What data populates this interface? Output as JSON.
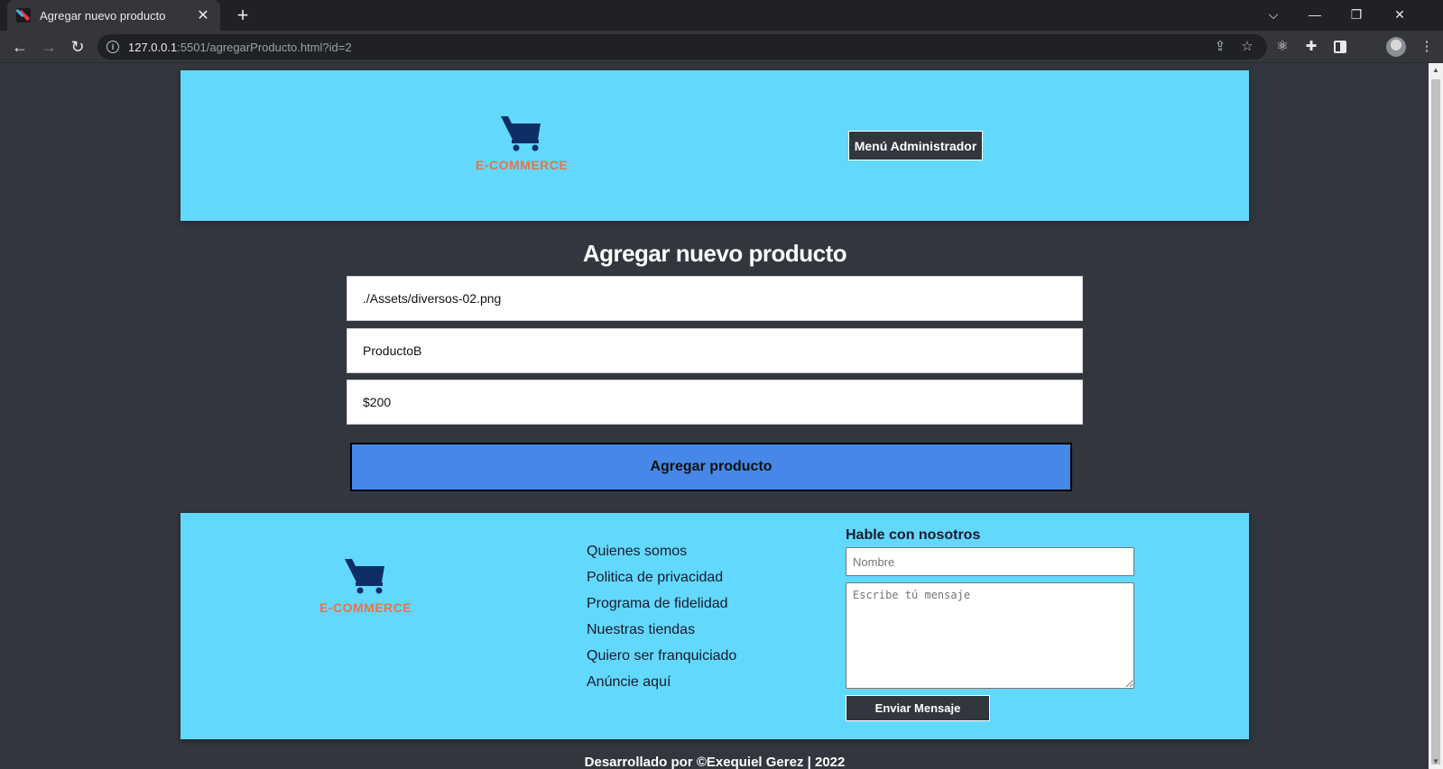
{
  "browser": {
    "tab_title": "Agregar nuevo producto",
    "url_host": "127.0.0.1",
    "url_rest": ":5501/agregarProducto.html?id=2"
  },
  "header": {
    "logo_text": "E-COMMERCE",
    "admin_button": "Menú Administrador"
  },
  "form": {
    "title": "Agregar nuevo producto",
    "image_value": "./Assets/diversos-02.png",
    "name_value": "ProductoB",
    "price_value": "$200",
    "submit_label": "Agregar producto"
  },
  "footer": {
    "logo_text": "E-COMMERCE",
    "links": [
      "Quienes somos",
      "Politica de privacidad",
      "Programa de fidelidad",
      "Nuestras tiendas",
      "Quiero ser franquiciado",
      "Anúncie aquí"
    ],
    "contact_title": "Hable con nosotros",
    "name_placeholder": "Nombre",
    "message_placeholder": "Escribe tú mensaje",
    "send_label": "Enviar Mensaje",
    "credits": "Desarrollado por ©Exequiel Gerez | 2022"
  },
  "colors": {
    "page_bg": "#32363e",
    "header_bg": "#62d8fc",
    "button_blue": "#4687e8",
    "logo_orange": "#e8734a",
    "cart_navy": "#0d2f66"
  }
}
